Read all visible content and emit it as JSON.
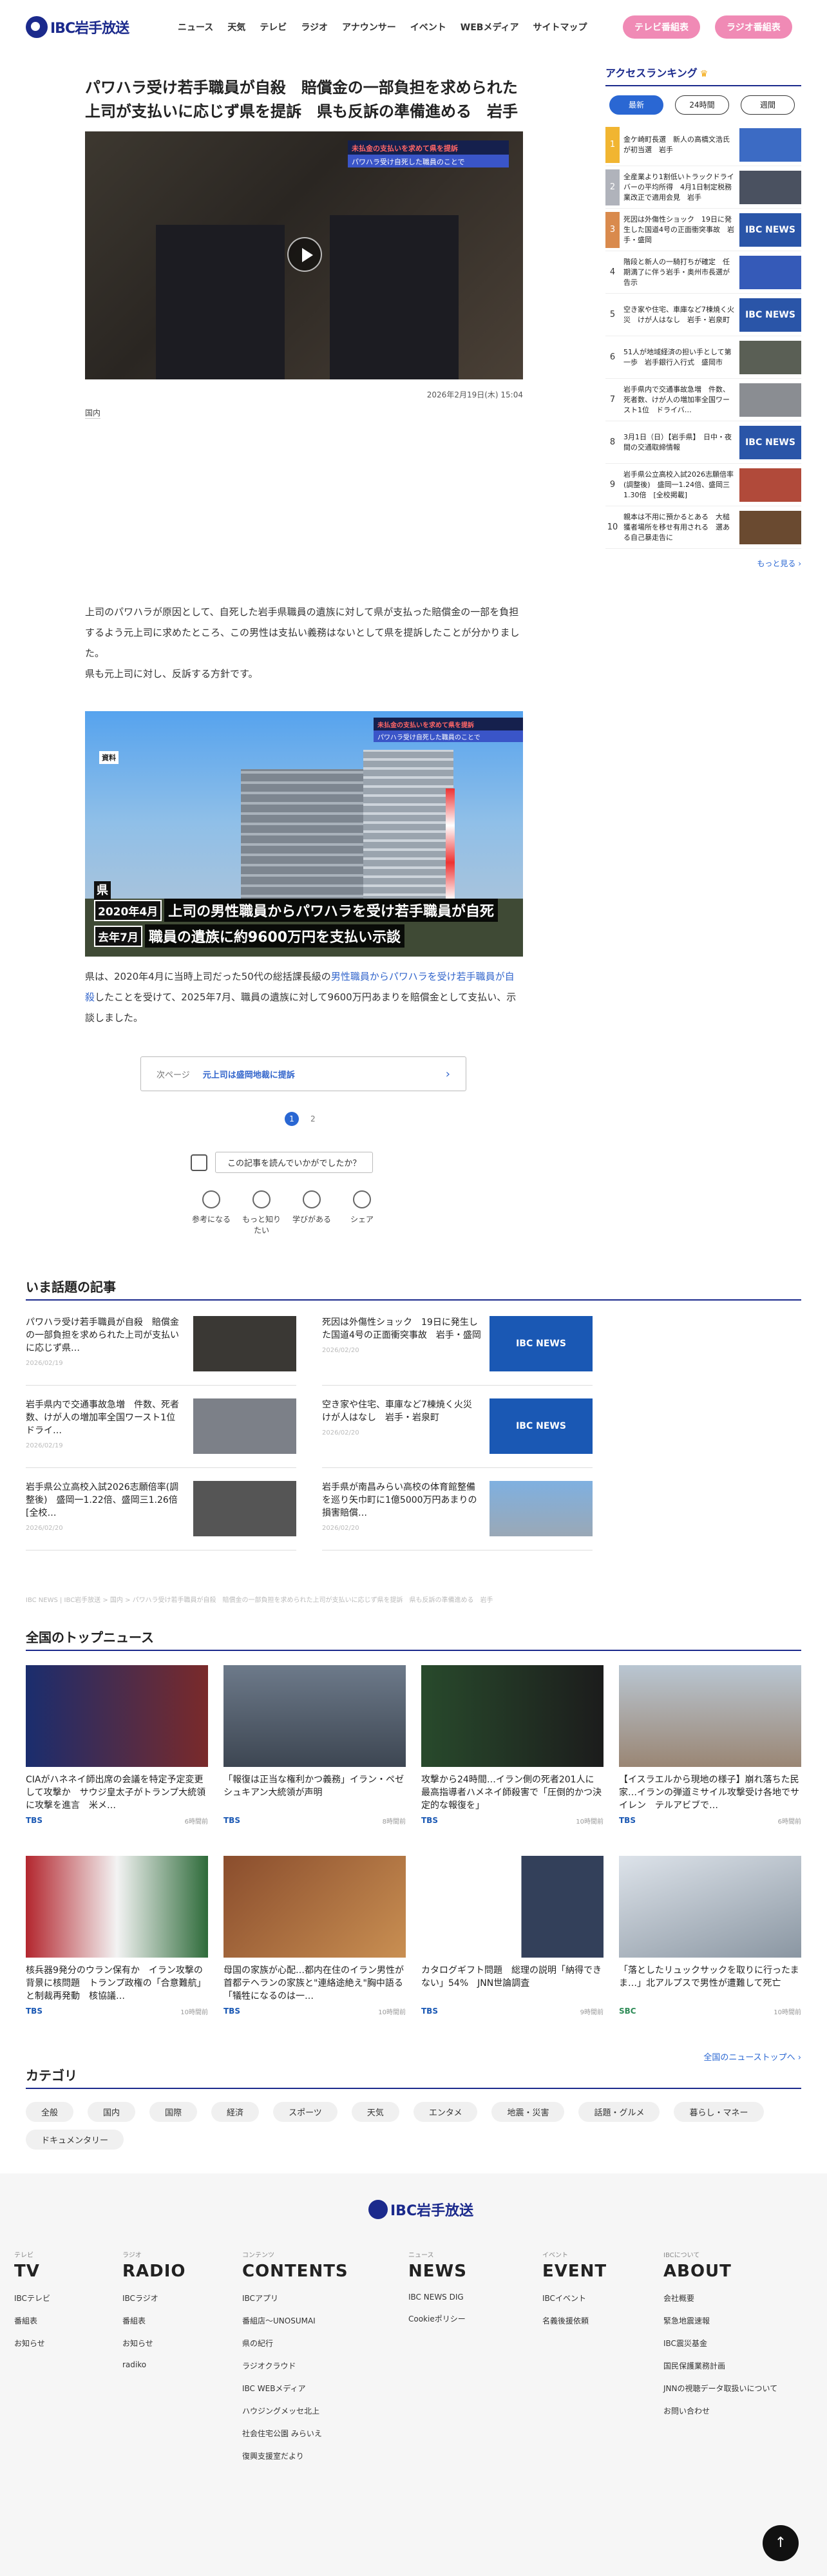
{
  "header": {
    "logo": "IBC岩手放送",
    "nav": [
      "ニュース",
      "天気",
      "テレビ",
      "ラジオ",
      "アナウンサー",
      "イベント",
      "WEBメディア",
      "サイトマップ"
    ],
    "btn_tv": "テレビ番組表",
    "btn_radio": "ラジオ番組表"
  },
  "article": {
    "title": "パワハラ受け若手職員が自殺　賠償金の一部負担を求められた上司が支払いに応じず県を提訴　県も反訴の準備進める　岩手",
    "hero_tel1a": "未払金の支払いを求めて",
    "hero_tel1b": "県を提訴",
    "hero_tel2": "パワハラ受け自死した職員のことで",
    "date": "2026年2月19日(木) 15:04",
    "category": "国内",
    "p1": "上司のパワハラが原因として、自死した岩手県職員の遺族に対して県が支払った賠償金の一部を負担するよう元上司に求めたところ、この男性は支払い義務はないとして県を提訴したことが分かりました。",
    "p2": "県も元上司に対し、反訴する方針です。",
    "img_tel1a": "未払金の支払いを求めて",
    "img_tel1b": "県を提訴",
    "img_tel2": "パワハラ受け自死した職員のことで",
    "shiryo": "資料",
    "ken": "県",
    "cap_y1": "2020年4月",
    "cap_l1": "上司の男性職員からパワハラを受け若手職員が自死",
    "cap_y2": "去年7月",
    "cap_l2": "職員の遺族に約9600万円を支払い示談",
    "p3a": "県は、2020年4月に当時上司だった50代の総括課長級の",
    "p3link": "男性職員からパワハラを受け若手職員が自殺",
    "p3b": "したことを受けて、2025年7月、職員の遺族に対して9600万円あまりを賠償金として支払い、示談しました。",
    "next_label": "次ページ",
    "next_title": "元上司は盛岡地裁に提訴",
    "pages": [
      "1",
      "2"
    ],
    "survey": "この記事を読んでいかがでしたか？",
    "reactions": [
      "参考になる",
      "もっと知りたい",
      "学びがある",
      "シェア"
    ]
  },
  "ranking": {
    "title": "アクセスランキング",
    "tabs": [
      "最新",
      "24時間",
      "週間"
    ],
    "more": "もっと見る ›",
    "items": [
      {
        "n": "1",
        "t": "金ケ崎町長選　新人の高橋文浩氏が初当選　岩手"
      },
      {
        "n": "2",
        "t": "全産業より1割低いトラックドライバーの平均所得　4月1日制定税務業改正で適用会見　岩手"
      },
      {
        "n": "3",
        "t": "死因は外傷性ショック　19日に発生した国道4号の正面衝突事故　岩手・盛岡"
      },
      {
        "n": "4",
        "t": "階段と新人の一騎打ちが確定　任期満了に伴う岩手・奥州市長選が告示"
      },
      {
        "n": "5",
        "t": "空き家や住宅、車庫など7棟焼く火災　けが人はなし　岩手・岩泉町"
      },
      {
        "n": "6",
        "t": "51人が地域経済の担い手として第一歩　岩手銀行入行式　盛岡市"
      },
      {
        "n": "7",
        "t": "岩手県内で交通事故急増　件数、死者数、けが人の増加率全国ワースト1位　ドライバ…"
      },
      {
        "n": "8",
        "t": "3月1日（日）【岩手県】　日中・夜間の交通取締情報"
      },
      {
        "n": "9",
        "t": "岩手県公立高校入試2026志願倍率(調整後)　盛岡一1.24倍、盛岡三1.30倍　[全校掲載]"
      },
      {
        "n": "10",
        "t": "親本は不用に預かるとある　大槌獲者場所を移せ有用される　選ある自己暴走告に"
      }
    ]
  },
  "hot": {
    "title": "いま話題の記事",
    "items": [
      {
        "t": "パワハラ受け若手職員が自殺　賠償金の一部負担を求められた上司が支払いに応じず県…",
        "d": "2026/02/19"
      },
      {
        "t": "死因は外傷性ショック　19日に発生した国道4号の正面衝突事故　岩手・盛岡",
        "d": "2026/02/20"
      },
      {
        "t": "岩手県内で交通事故急増　件数、死者数、けが人の増加率全国ワースト1位　ドライ…",
        "d": "2026/02/19"
      },
      {
        "t": "空き家や住宅、車庫など7棟焼く火災　けが人はなし　岩手・岩泉町",
        "d": "2026/02/20"
      },
      {
        "t": "岩手県公立高校入試2026志願倍率(調整後)　盛岡一1.22倍、盛岡三1.26倍　[全校…",
        "d": "2026/02/20"
      },
      {
        "t": "岩手県が南昌みらい高校の体育館整備を巡り矢巾町に1億5000万円あまりの損害賠償…",
        "d": "2026/02/20"
      }
    ],
    "news_label": "IBC NEWS"
  },
  "breadcrumb": "IBC NEWS | IBC岩手放送 > 国内 > パワハラ受け若手職員が自殺　賠償金の一部負担を求められた上司が支払いに応じず県を提訴　県も反訴の準備進める　岩手",
  "top": {
    "title": "全国のトップニュース",
    "all": "全国のニューストップへ ›",
    "items": [
      {
        "t": "CIAがハネネイ師出席の会議を特定予定変更して攻撃か　サウジ皇太子がトランプ大統領に攻撃を進言　米メ…",
        "src": "TBS",
        "time": "6時間前"
      },
      {
        "t": "「報復は正当な権利かつ義務」イラン・ペゼシュキアン大統領が声明",
        "src": "TBS",
        "time": "8時間前"
      },
      {
        "t": "攻撃から24時間…イラン側の死者201人に　最高指導者ハメネイ師殺害で「圧倒的かつ決定的な報復を」",
        "src": "TBS",
        "time": "10時間前"
      },
      {
        "t": "【イスラエルから現地の様子】崩れ落ちた民家…イランの弾道ミサイル攻撃受け各地でサイレン　テルアビブで…",
        "src": "TBS",
        "time": "6時間前"
      },
      {
        "t": "核兵器9発分のウラン保有か　イラン攻撃の背景に核問題　トランプ政権の「合意難航」と制裁再発動　核協議…",
        "src": "TBS",
        "time": "10時間前"
      },
      {
        "t": "母国の家族が心配…都内在住のイラン男性が首都テヘランの家族と\"連絡途絶え\"胸中語る「犠牲になるのは一…",
        "src": "TBS",
        "time": "10時間前"
      },
      {
        "t": "カタログギフト問題　総理の説明「納得できない」54%　JNN世論調査",
        "src": "TBS",
        "time": "9時間前"
      },
      {
        "t": "「落としたリュックサックを取りに行ったまま…」北アルプスで男性が遭難して死亡",
        "src": "SBC",
        "time": "10時間前"
      }
    ]
  },
  "categories": {
    "title": "カテゴリ",
    "items": [
      "全般",
      "国内",
      "国際",
      "経済",
      "スポーツ",
      "天気",
      "エンタメ",
      "地震・災害",
      "話題・グルメ",
      "暮らし・マネー",
      "ドキュメンタリー"
    ]
  },
  "footer": {
    "logo": "IBC岩手放送",
    "cols": [
      {
        "k": "テレビ",
        "h": "TV",
        "items": [
          "IBCテレビ",
          "番組表",
          "お知らせ"
        ]
      },
      {
        "k": "ラジオ",
        "h": "RADIO",
        "items": [
          "IBCラジオ",
          "番組表",
          "お知らせ",
          "radiko"
        ]
      },
      {
        "k": "コンテンツ",
        "h": "CONTENTS",
        "items": [
          "IBCアプリ",
          "番組店〜UNOSUMAI",
          "県の紀行",
          "ラジオクラウド",
          "IBC WEBメディア",
          "ハウジングメッセ北上",
          "社会住宅公園 みらいえ",
          "復興支援室だより"
        ]
      },
      {
        "k": "ニュース",
        "h": "NEWS",
        "items": [
          "IBC NEWS DIG",
          "Cookieポリシー"
        ]
      },
      {
        "k": "イベント",
        "h": "EVENT",
        "items": [
          "IBCイベント",
          "名義後援依頼"
        ]
      },
      {
        "k": "IBCについて",
        "h": "ABOUT",
        "items": [
          "会社概要",
          "緊急地震速報",
          "IBC震災基金",
          "国民保護業務計画",
          "JNNの視聴データ取扱いについて",
          "お問い合わせ"
        ]
      }
    ]
  },
  "totop": "↑"
}
